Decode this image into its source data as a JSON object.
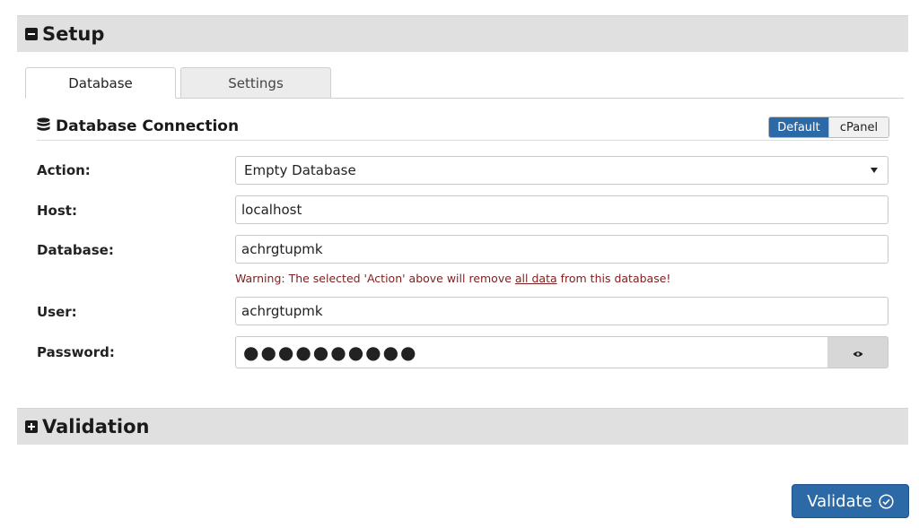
{
  "setup": {
    "title": "Setup"
  },
  "tabs": [
    {
      "label": "Database",
      "active": true
    },
    {
      "label": "Settings",
      "active": false
    }
  ],
  "connection": {
    "title": "Database Connection",
    "toggle": {
      "options": [
        "Default",
        "cPanel"
      ],
      "selected": "Default"
    }
  },
  "form": {
    "action": {
      "label": "Action:",
      "value": "Empty Database"
    },
    "host": {
      "label": "Host:",
      "value": "localhost"
    },
    "database": {
      "label": "Database:",
      "value": "achrgtupmk"
    },
    "warning": {
      "prefix": "Warning: The selected 'Action' above will remove ",
      "link": "all data",
      "suffix": " from this database!"
    },
    "user": {
      "label": "User:",
      "value": "achrgtupmk"
    },
    "password": {
      "label": "Password:",
      "value": "●●●●●●●●●●"
    }
  },
  "validation": {
    "title": "Validation"
  },
  "validate_button": {
    "label": "Validate"
  },
  "colors": {
    "accent": "#2c6aa7",
    "warning": "#7d1f1f",
    "header_bg": "#e0e0e0"
  }
}
